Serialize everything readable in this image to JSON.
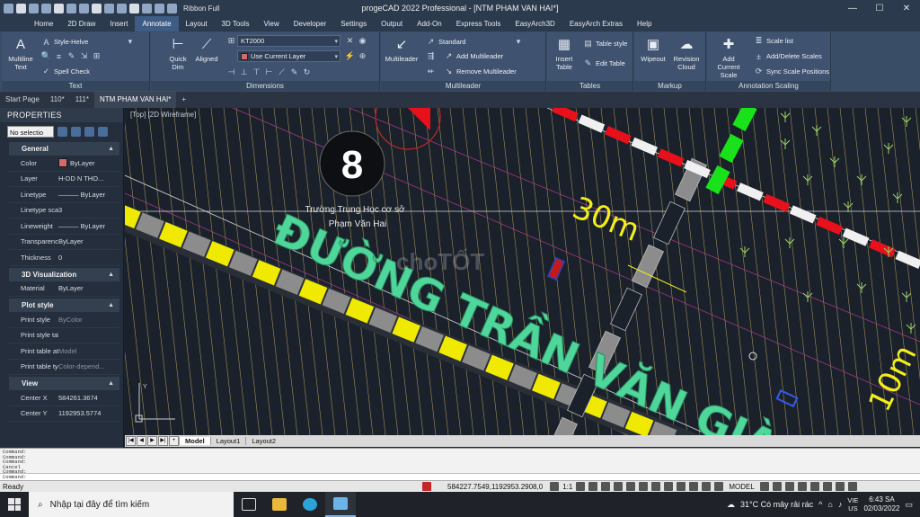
{
  "title": "progeCAD 2022 Professional - [NTM PHAM VAN HAI*]",
  "qat": {
    "workspace": "Ribbon Full"
  },
  "tabs": [
    "Home",
    "2D Draw",
    "Insert",
    "Annotate",
    "Layout",
    "3D Tools",
    "View",
    "Developer",
    "Settings",
    "Output",
    "Add-On",
    "Express Tools",
    "EasyArch3D",
    "EasyArch Extras",
    "Help"
  ],
  "active_tab": "Annotate",
  "ribbon": {
    "text": {
      "label": "Text",
      "multiline": "Multiline Text",
      "style": "Style-Helve",
      "spell": "Spell Check"
    },
    "dimensions": {
      "label": "Dimensions",
      "quick_dim": "Quick Dim",
      "aligned": "Aligned",
      "dimstyle": "KT2000",
      "layer": "Use Current Layer"
    },
    "multileader": {
      "label": "Multileader",
      "button": "Multileader",
      "style": "Standard",
      "add": "Add Multileader",
      "remove": "Remove Multileader"
    },
    "tables": {
      "label": "Tables",
      "insert": "Insert Table",
      "style": "Table style",
      "edit": "Edit Table"
    },
    "markup": {
      "label": "Markup",
      "wipeout": "Wipeout",
      "revision": "Revision Cloud"
    },
    "scaling": {
      "label": "Annotation Scaling",
      "add_current": "Add Current Scale",
      "scale_list": "Scale list",
      "add_delete": "Add/Delete Scales",
      "sync": "Sync Scale Positions"
    }
  },
  "file_tabs": [
    "Start Page",
    "110*",
    "111*",
    "NTM PHAM VAN HAI*"
  ],
  "active_file_tab": "NTM PHAM VAN HAI*",
  "properties": {
    "title": "PROPERTIES",
    "selection": "No selectio",
    "sections": [
      {
        "name": "General",
        "rows": [
          {
            "key": "Color",
            "value": "ByLayer",
            "swatch": "#d46b6b"
          },
          {
            "key": "Layer",
            "value": "H-DD N THO..."
          },
          {
            "key": "Linetype",
            "value": "——— ByLayer"
          },
          {
            "key": "Linetype scale",
            "value": "3"
          },
          {
            "key": "Lineweight",
            "value": "——— ByLayer"
          },
          {
            "key": "Transparency",
            "value": "ByLayer"
          },
          {
            "key": "Thickness",
            "value": "0"
          }
        ]
      },
      {
        "name": "3D Visualization",
        "rows": [
          {
            "key": "Material",
            "value": "ByLayer"
          }
        ]
      },
      {
        "name": "Plot style",
        "rows": [
          {
            "key": "Print style",
            "value": "ByColor",
            "dim": true
          },
          {
            "key": "Print style table",
            "value": ""
          },
          {
            "key": "Print table att...",
            "value": "Model",
            "dim": true
          },
          {
            "key": "Print table type",
            "value": "Color-depend...",
            "dim": true
          }
        ]
      },
      {
        "name": "View",
        "rows": [
          {
            "key": "Center X",
            "value": "584261.3674"
          },
          {
            "key": "Center Y",
            "value": "1192953.5774"
          }
        ]
      }
    ]
  },
  "viewport": {
    "label": "[Top] [2D Wireframe]",
    "circle_number": "8",
    "school_line1": "Trường Trung Học cơ sở",
    "school_line2": "Phạm Văn Hai",
    "street": "ĐƯỜNG TRẦN VĂN GIÀU",
    "dim_30": "30m",
    "dim_10": "10m",
    "watermark": "choTỐT",
    "colors": {
      "road_yellow": "#f0ea00",
      "road_gray": "#8c8c8c",
      "street_text": "#4fd69a",
      "dash_red": "#e8101a",
      "dash_green": "#19e21a",
      "hatch": "#c8b26a"
    }
  },
  "layout_tabs": [
    "Model",
    "Layout1",
    "Layout2"
  ],
  "command_lines": [
    "Command:",
    "Command:",
    "Command:",
    "Cancel",
    "Command:"
  ],
  "status": {
    "ready": "Ready",
    "coords": "584227.7549,1192953.2908,0",
    "scale": "1:1",
    "model": "MODEL"
  },
  "taskbar": {
    "search_placeholder": "Nhập tại đây để tìm kiếm",
    "weather": "31°C  Có mây rải rác",
    "lang_1": "VIE",
    "lang_2": "US",
    "time": "6:43 SA",
    "date": "02/03/2022"
  }
}
